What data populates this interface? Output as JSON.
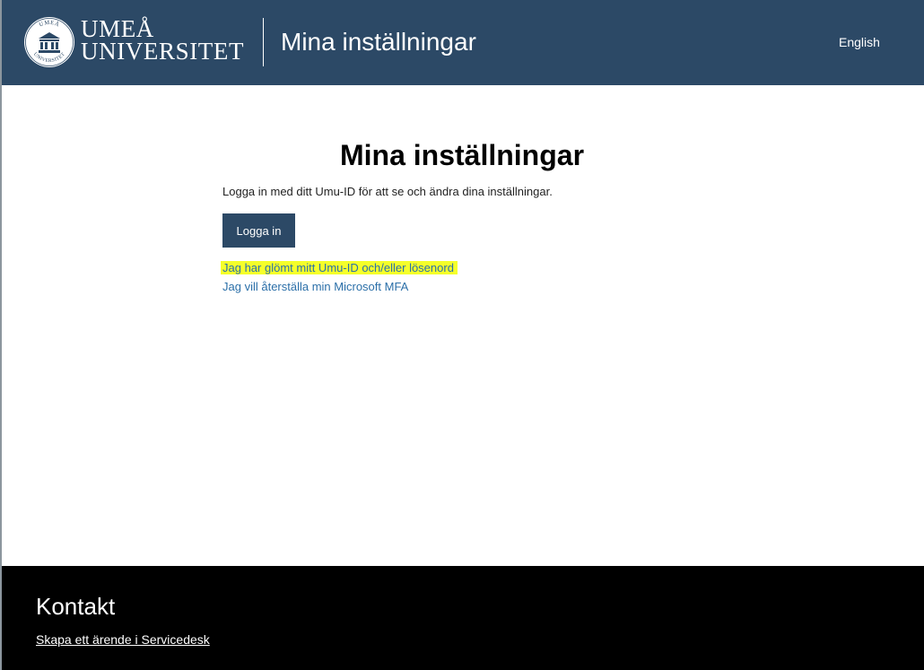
{
  "header": {
    "logo_line1": "UMEÅ",
    "logo_line2": "UNIVERSITET",
    "seal_top": "UMEÅ",
    "seal_bottom": "UNIVERSITET",
    "title": "Mina inställningar",
    "language_link": "English",
    "background_color": "#2c4966",
    "logo_icon": "umea-university-seal-icon"
  },
  "main": {
    "title": "Mina inställningar",
    "intro": "Logga in med ditt Umu-ID för att se och ändra dina inställningar.",
    "login_button": "Logga in",
    "forgot_link": "Jag har glömt mitt Umu-ID och/eller lösenord",
    "mfa_link": "Jag vill återställa min Microsoft MFA",
    "highlight_color": "#f5ff2a",
    "link_color": "#2b6fa8"
  },
  "footer": {
    "title": "Kontakt",
    "servicedesk_link": "Skapa ett ärende i Servicedesk",
    "background_color": "#000000"
  }
}
